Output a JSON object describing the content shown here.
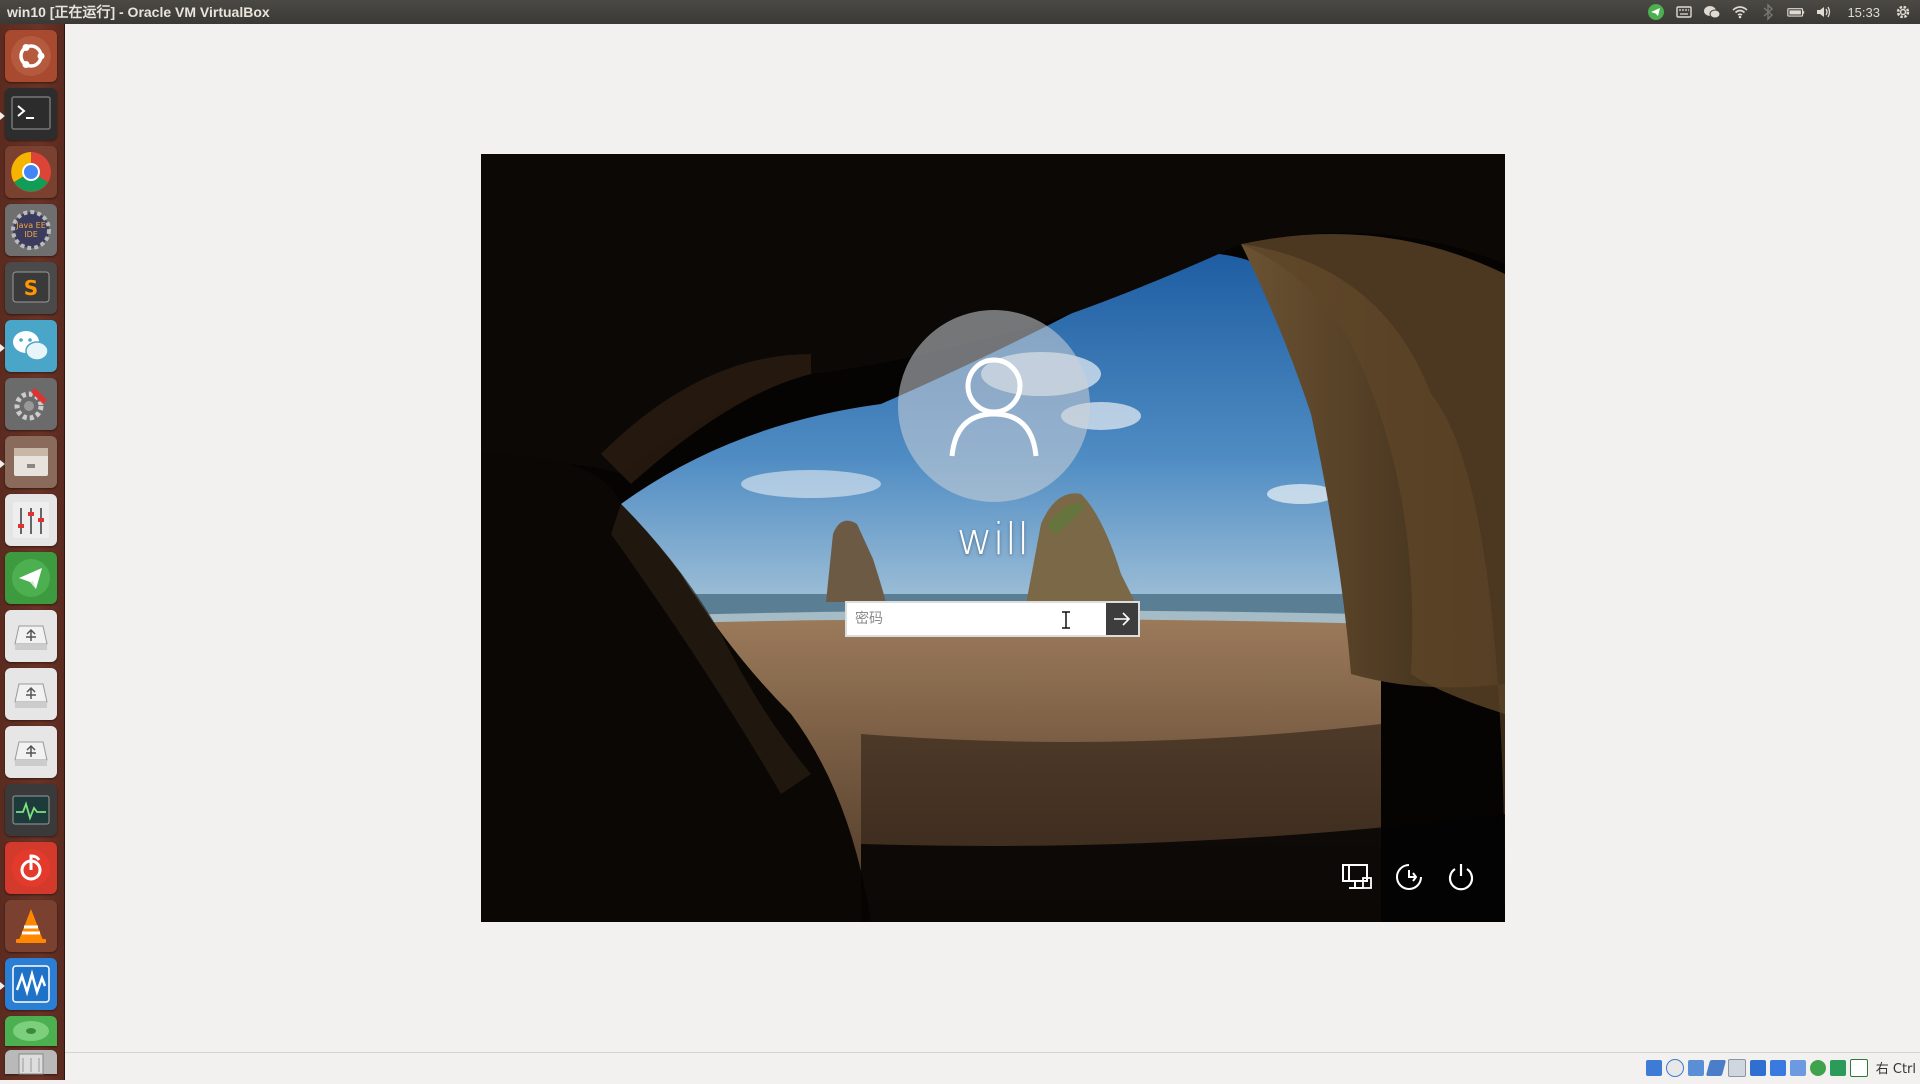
{
  "window": {
    "title": "win10 [正在运行] - Oracle VM VirtualBox"
  },
  "tray": {
    "clock": "15:33"
  },
  "launcher": {
    "items": [
      {
        "name": "ubuntu-dash-icon"
      },
      {
        "name": "terminal-icon"
      },
      {
        "name": "chrome-icon"
      },
      {
        "name": "java-ee-ide-icon"
      },
      {
        "name": "sublime-text-icon"
      },
      {
        "name": "wechat-icon"
      },
      {
        "name": "system-settings-icon"
      },
      {
        "name": "file-manager-icon"
      },
      {
        "name": "sound-settings-icon"
      },
      {
        "name": "telegram-icon"
      },
      {
        "name": "usb-drive-icon"
      },
      {
        "name": "usb-drive-icon"
      },
      {
        "name": "usb-drive-icon"
      },
      {
        "name": "system-monitor-icon"
      },
      {
        "name": "netease-music-icon"
      },
      {
        "name": "vlc-icon"
      },
      {
        "name": "virtualbox-icon"
      }
    ]
  },
  "login": {
    "username": "will",
    "password_placeholder": "密码"
  },
  "statusbar": {
    "host_key": "右 Ctrl"
  },
  "colors": {
    "launcher_bg": "#6b3427",
    "topbar_bg": "#3c3b37",
    "window_bg": "#f2f1f0",
    "submit_bg": "#3d3d3d"
  }
}
